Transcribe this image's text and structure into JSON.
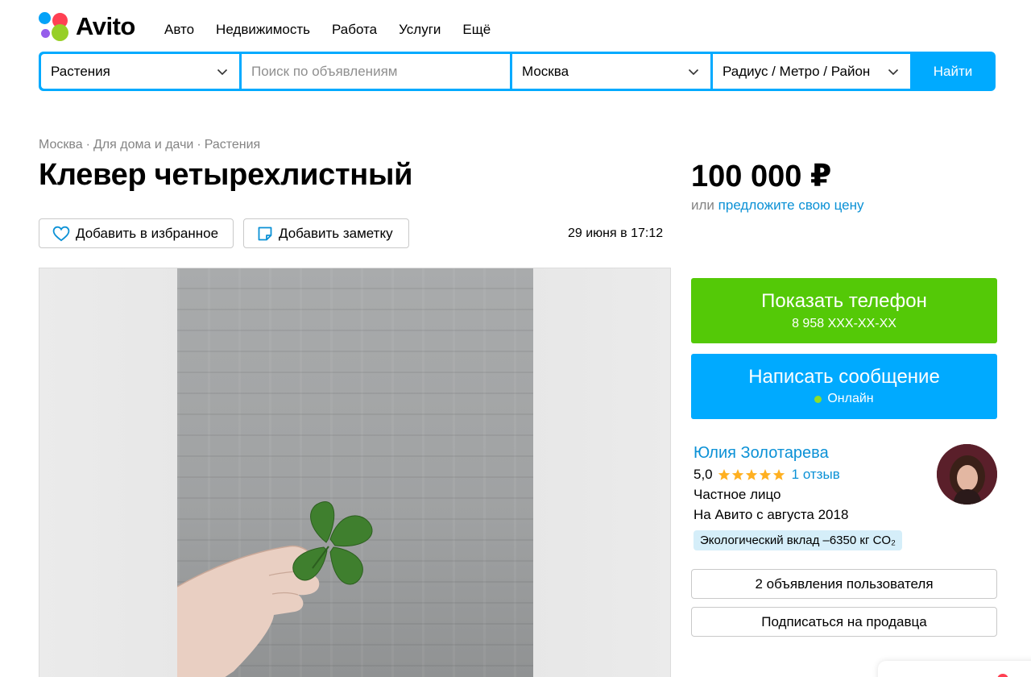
{
  "brand": {
    "name": "Avito",
    "colors": {
      "blue": "#04a2f8",
      "red": "#ff4053",
      "purple": "#965eeb",
      "green": "#97cf26"
    }
  },
  "nav": {
    "items": [
      "Авто",
      "Недвижимость",
      "Работа",
      "Услуги",
      "Ещё"
    ]
  },
  "search": {
    "category": "Растения",
    "query_placeholder": "Поиск по объявлениям",
    "city": "Москва",
    "radius": "Радиус / Метро / Район",
    "button": "Найти",
    "accent": "#00aaff"
  },
  "breadcrumb": [
    "Москва",
    "Для дома и дачи",
    "Растения"
  ],
  "breadcrumb_sep": "·",
  "listing": {
    "title": "Клевер четырехлистный",
    "price": "100 000 ₽",
    "price_offer_prefix": "или",
    "price_offer_link": "предложите свою цену",
    "date": "29 июня в 17:12",
    "favorite_label": "Добавить в избранное",
    "note_label": "Добавить заметку"
  },
  "contact": {
    "phone_label": "Показать телефон",
    "phone_masked": "8 958 XXX-XX-XX",
    "phone_color": "#54c907",
    "message_label": "Написать сообщение",
    "online_status": "Онлайн"
  },
  "seller": {
    "name": "Юлия Золотарева",
    "rating": "5,0",
    "stars": 5,
    "reviews": "1 отзыв",
    "type": "Частное лицо",
    "since": "На Авито с августа 2018",
    "eco_badge": "Экологический вклад –6350 кг CO₂",
    "ads_button": "2 объявления пользователя",
    "subscribe_button": "Подписаться на продавца"
  },
  "icons": [
    "heart-icon",
    "note-icon",
    "chevron-down-icon",
    "star-icon",
    "online-dot-icon"
  ]
}
